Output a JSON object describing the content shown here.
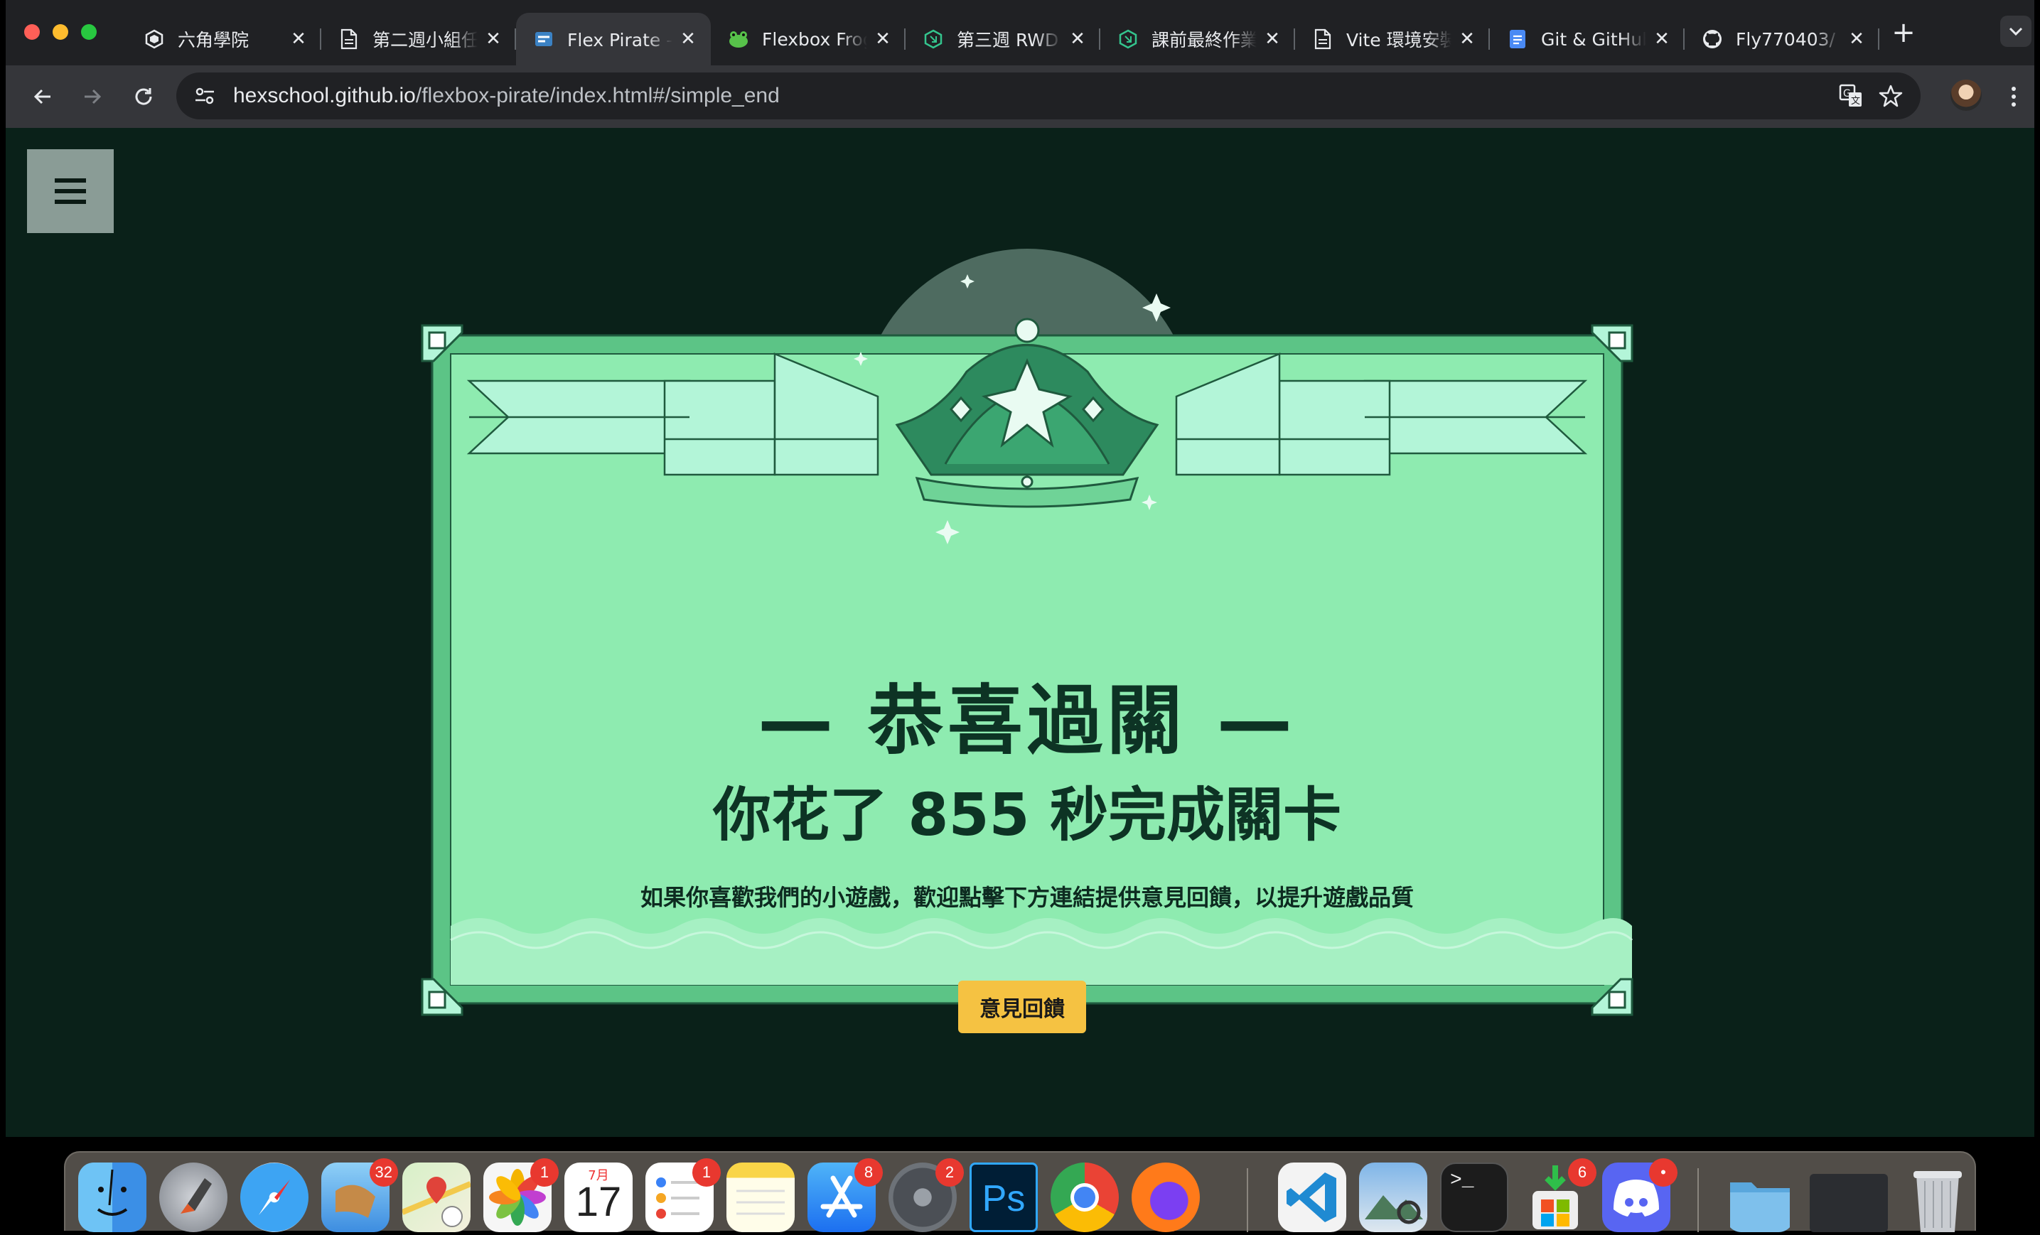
{
  "browser": {
    "tabs": [
      {
        "title": "六角學院",
        "icon": "hexschool-logo-icon",
        "active": false
      },
      {
        "title": "第二週小組任務",
        "icon": "document-icon",
        "active": false
      },
      {
        "title": "Flex Pirate - Flexbox 遊戲",
        "icon": "flex-pirate-icon",
        "active": true
      },
      {
        "title": "Flexbox Froggy",
        "icon": "frog-icon",
        "active": false
      },
      {
        "title": "第三週 RWD",
        "icon": "hexagon-icon",
        "active": false
      },
      {
        "title": "課前最終作業",
        "icon": "hexagon-icon",
        "active": false
      },
      {
        "title": "Vite 環境安裝",
        "icon": "document-icon",
        "active": false
      },
      {
        "title": "Git & GitHub",
        "icon": "google-docs-icon",
        "active": false
      },
      {
        "title": "Fly770403/",
        "icon": "github-icon",
        "active": false
      }
    ],
    "url_host": "hexschool.github.io",
    "url_path": "/flexbox-pirate/index.html#/simple_end"
  },
  "page": {
    "title": "— 恭喜過關 —",
    "time_prefix": "你花了",
    "seconds": "855",
    "time_suffix": "秒完成關卡",
    "subtitle": "如果你喜歡我們的小遊戲，歡迎點擊下方連結提供意見回饋，以提升遊戲品質",
    "feedback_button": "意見回饋"
  },
  "dock": {
    "apps": [
      {
        "name": "Finder",
        "icon": "finder-icon"
      },
      {
        "name": "Launchpad",
        "icon": "launchpad-icon"
      },
      {
        "name": "Safari",
        "icon": "safari-icon"
      },
      {
        "name": "Mail",
        "icon": "mail-icon",
        "badge": "32"
      },
      {
        "name": "Maps",
        "icon": "maps-icon"
      },
      {
        "name": "Photos",
        "icon": "photos-icon",
        "badge": "1"
      },
      {
        "name": "Calendar",
        "icon": "calendar-icon",
        "month": "7月",
        "day": "17"
      },
      {
        "name": "Reminders",
        "icon": "reminders-icon",
        "badge": "1"
      },
      {
        "name": "Notes",
        "icon": "notes-icon"
      },
      {
        "name": "App Store",
        "icon": "app-store-icon",
        "badge": "8"
      },
      {
        "name": "System Settings",
        "icon": "system-settings-icon",
        "badge": "2"
      },
      {
        "name": "Photoshop",
        "icon": "photoshop-icon",
        "label": "Ps"
      },
      {
        "name": "Chrome",
        "icon": "chrome-icon"
      },
      {
        "name": "Firefox",
        "icon": "firefox-icon"
      },
      {
        "name": "VS Code",
        "icon": "vscode-icon"
      },
      {
        "name": "Preview",
        "icon": "preview-icon"
      },
      {
        "name": "Terminal",
        "icon": "terminal-icon",
        "label": ">_"
      },
      {
        "name": "Microsoft Installer",
        "icon": "installer-icon",
        "badge": "6"
      },
      {
        "name": "Discord",
        "icon": "discord-icon",
        "badge": "•"
      },
      {
        "name": "Downloads",
        "icon": "folder-icon"
      },
      {
        "name": "Discord Window",
        "icon": "window-thumbnail-icon"
      },
      {
        "name": "Trash",
        "icon": "trash-icon"
      }
    ]
  },
  "colors": {
    "page_bg": "#0a2119",
    "cert_fill": "#8eebb0",
    "cert_border": "#5cc486",
    "banner": "#b3f5d8",
    "ink": "#0d3324",
    "button": "#f5c242",
    "chrome_dark": "#202124",
    "chrome_toolbar": "#35363a"
  }
}
